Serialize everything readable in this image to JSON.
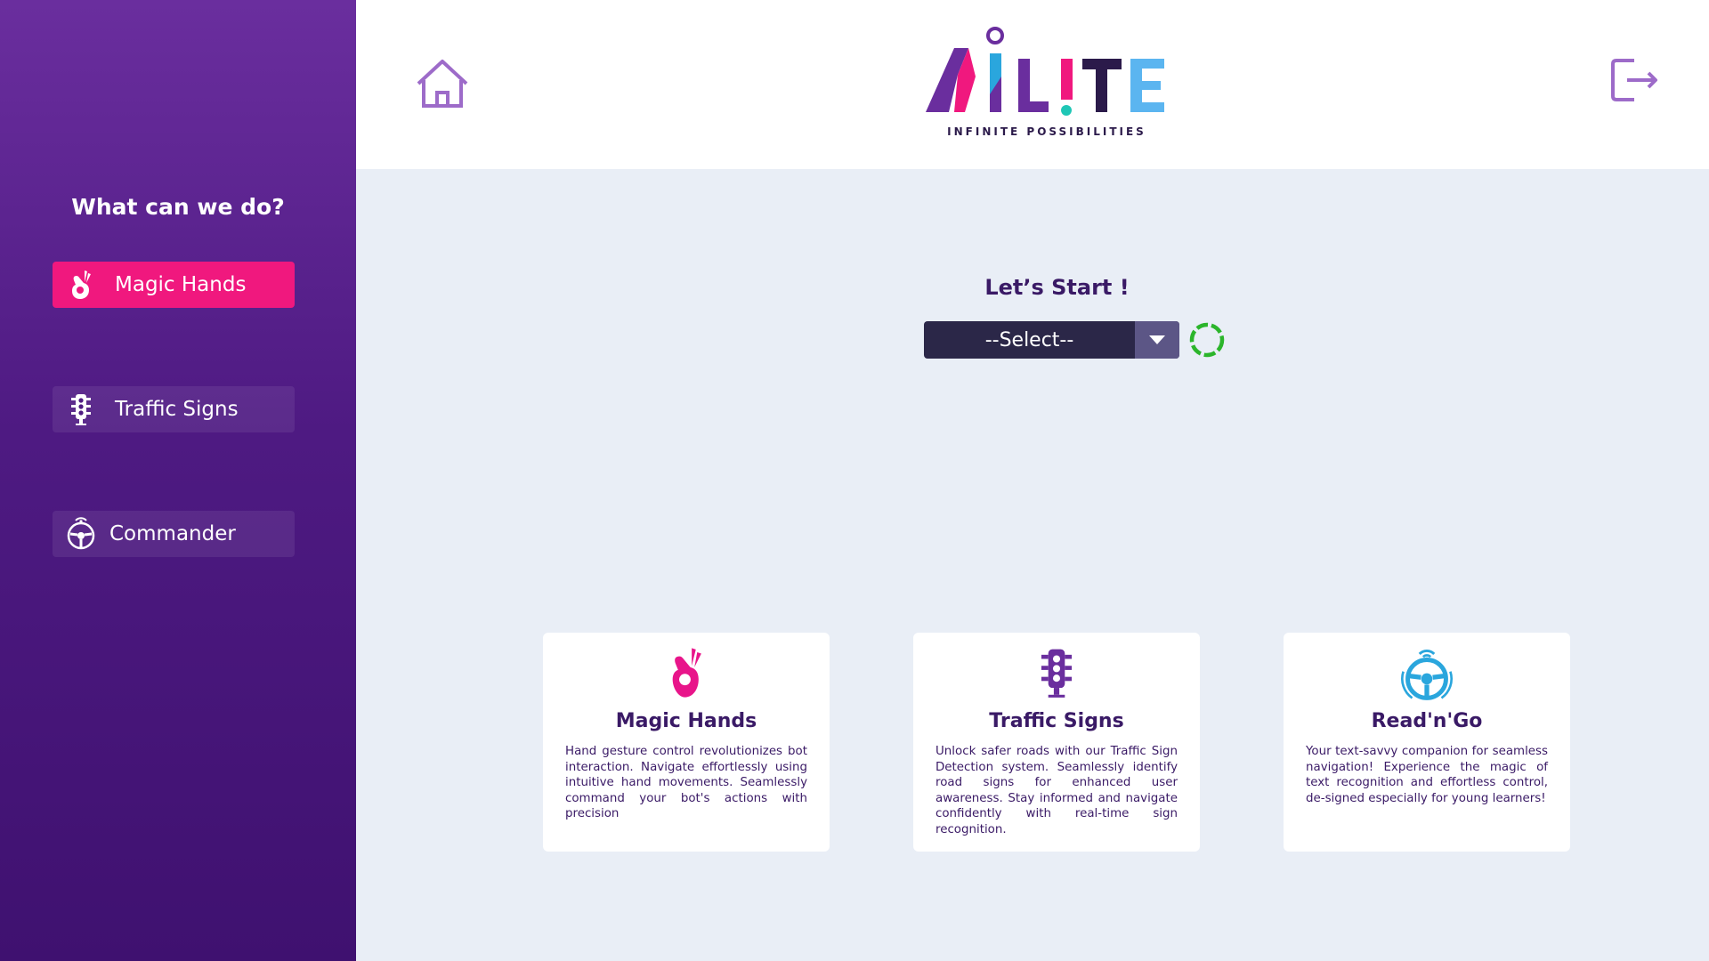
{
  "sidebar": {
    "title": "What can we do?",
    "items": [
      {
        "label": "Magic Hands",
        "icon": "hand-gesture-icon",
        "active": true
      },
      {
        "label": "Traffic Signs",
        "icon": "traffic-light-icon",
        "active": false
      },
      {
        "label": "Commander",
        "icon": "steering-wheel-icon",
        "active": false
      }
    ]
  },
  "header": {
    "home_icon": "home-icon",
    "logout_icon": "logout-icon",
    "logo": {
      "text": "AILITE",
      "tagline": "INFINITE POSSIBILITIES"
    }
  },
  "main": {
    "start_label": "Let’s Start !",
    "select": {
      "value": "--Select--"
    },
    "spinner": "loading-spinner"
  },
  "cards": [
    {
      "title": "Magic Hands",
      "icon": "hand-gesture-icon",
      "text": "Hand gesture control revolutionizes bot interaction. Navigate effortlessly using intuitive hand movements. Seamlessly command your bot's actions with precision"
    },
    {
      "title": "Traffic Signs",
      "icon": "traffic-light-icon",
      "text": "Unlock safer roads with our Traffic Sign Detection system. Seamlessly identify road signs for enhanced user awareness. Stay informed and navigate confidently with real-time sign recognition."
    },
    {
      "title": "Read'n'Go",
      "icon": "steering-wheel-icon",
      "text": "Your text-savvy companion for seamless navigation! Experience the magic of text recognition and effortless control, de-signed especially for young learners!"
    }
  ],
  "colors": {
    "sidebar_top": "#6a2e9e",
    "sidebar_bottom": "#3f1170",
    "accent_pink": "#f0187e",
    "dark_navy": "#2b2748",
    "main_bg": "#e9eef6",
    "spinner_green": "#2bb52b",
    "title_purple": "#3a1a66",
    "steering_blue": "#2aa6dd"
  }
}
